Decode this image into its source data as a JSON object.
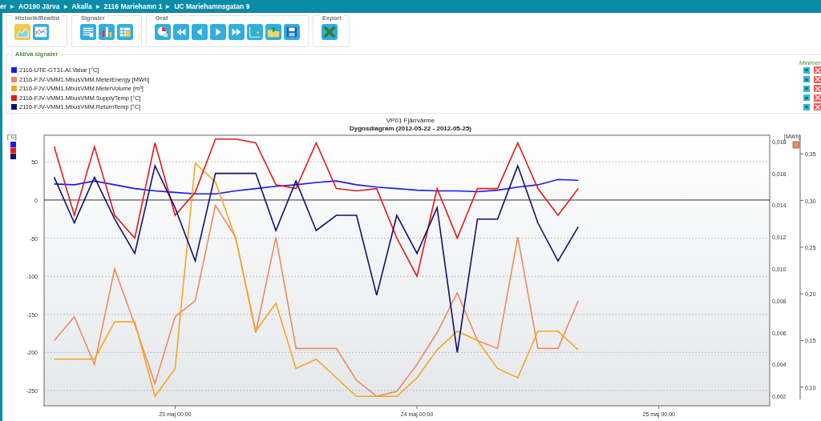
{
  "breadcrumb": {
    "separator": "▶",
    "items": [
      "er",
      "AO190 Järva",
      "Akalla",
      "2116 Mariehamn 1",
      "UC Mariehamnsgatan 9"
    ]
  },
  "toolbar": {
    "groups": [
      {
        "label": "Historik/Realtid",
        "buttons": [
          {
            "kind": "history",
            "selected": true
          },
          {
            "kind": "realtime",
            "selected": false
          }
        ]
      },
      {
        "label": "Signaler",
        "buttons": [
          {
            "kind": "list"
          },
          {
            "kind": "bars"
          },
          {
            "kind": "table"
          }
        ]
      },
      {
        "label": "Graf",
        "buttons": [
          {
            "kind": "pie"
          },
          {
            "kind": "rewind"
          },
          {
            "kind": "back"
          },
          {
            "kind": "forward"
          },
          {
            "kind": "fastforward"
          },
          {
            "kind": "scatter"
          },
          {
            "kind": "folder"
          },
          {
            "kind": "save"
          }
        ]
      },
      {
        "label": "Export",
        "buttons": [
          {
            "kind": "excel"
          }
        ]
      }
    ]
  },
  "signals": {
    "title": "Aktiva signaler",
    "column": "Minimer",
    "items": [
      {
        "name": "2116-UTE-GT31.AI.Value [°C]",
        "color": "#1a1aee"
      },
      {
        "name": "2116-FJV-VMM1.MbusVMM.MeterEnergy [MWh]",
        "color": "#f08a60"
      },
      {
        "name": "2116-FJV-VMM1.MbusVMM.MeterVolume [m³]",
        "color": "#f5a623"
      },
      {
        "name": "2116-FJV-VMM1.MbusVMM.SupplyTemp [°C]",
        "color": "#e81818"
      },
      {
        "name": "2116-FJV-VMM1.MbusVMM.ReturnTemp [°C]",
        "color": "#10106e"
      }
    ]
  },
  "chart": {
    "chart_data": {
      "type": "line",
      "title": "VP01 Fjärrvärme",
      "subtitle": "Dygnsdiagram (2012-05-22 - 2012-05-25)",
      "ylabel": "[°C]",
      "y2label": "[MWh]",
      "categories": [
        null,
        null,
        null,
        null,
        null,
        null,
        "23 maj 00:00",
        null,
        null,
        null,
        null,
        null,
        null,
        null,
        null,
        null,
        null,
        null,
        "24 maj 00:00",
        null,
        null,
        null,
        null,
        null,
        null,
        null,
        null,
        null,
        null,
        null,
        "25 maj 00:00",
        null,
        null,
        null,
        null,
        null
      ],
      "grid": true,
      "ylim": [
        -270,
        85
      ],
      "y2lim": [
        0.0014,
        0.0184
      ],
      "y3lim": [
        0.08,
        0.37
      ],
      "yticks": [
        50,
        0,
        -50,
        -100,
        -150,
        -200,
        -250
      ],
      "y2ticks": [
        {
          "value": 0.018,
          "label": "0,018"
        },
        {
          "value": 0.016,
          "label": "0,016"
        },
        {
          "value": 0.014,
          "label": "0,014"
        },
        {
          "value": 0.012,
          "label": "0,012"
        },
        {
          "value": 0.01,
          "label": "0,010"
        },
        {
          "value": 0.008,
          "label": "0,008"
        },
        {
          "value": 0.006,
          "label": "0,006"
        },
        {
          "value": 0.004,
          "label": "0,004"
        },
        {
          "value": 0.002,
          "label": "0,002"
        }
      ],
      "y3ticks": [
        {
          "value": 0.35,
          "label": "0,35"
        },
        {
          "value": 0.3,
          "label": "0,30"
        },
        {
          "value": 0.25,
          "label": "0,25"
        },
        {
          "value": 0.2,
          "label": "0,20"
        },
        {
          "value": 0.15,
          "label": "0,15"
        },
        {
          "value": 0.1,
          "label": "0,10"
        }
      ],
      "series": [
        {
          "color": "#1a1aee",
          "values": [
            21,
            20,
            25,
            20,
            15,
            12,
            10,
            8,
            8,
            12,
            15,
            18,
            20,
            23,
            25,
            20,
            17,
            15,
            13,
            12,
            12,
            11,
            13,
            17,
            20,
            27,
            26,
            null,
            null,
            null,
            null,
            null,
            null,
            null,
            null,
            null
          ]
        },
        {
          "color": "#f08a60",
          "axis": "y2",
          "values": [
            0.0055,
            0.007,
            0.004,
            0.01,
            0.0065,
            0.0028,
            0.007,
            0.008,
            0.014,
            0.012,
            0.006,
            0.012,
            0.005,
            0.005,
            0.005,
            0.003,
            0.002,
            0.0023,
            0.004,
            0.006,
            0.0085,
            0.0055,
            0.005,
            0.012,
            0.005,
            0.005,
            0.008,
            null,
            null,
            null,
            null,
            null,
            null,
            null,
            null,
            null
          ]
        },
        {
          "color": "#f5a623",
          "axis": "y3",
          "values": [
            0.13,
            0.13,
            0.13,
            0.17,
            0.17,
            0.09,
            0.12,
            0.34,
            0.32,
            0.26,
            0.16,
            0.19,
            0.12,
            0.13,
            0.11,
            0.09,
            0.09,
            0.09,
            0.11,
            0.14,
            0.16,
            0.15,
            0.12,
            0.11,
            0.16,
            0.16,
            0.14,
            null,
            null,
            null,
            null,
            null,
            null,
            null,
            null,
            null
          ]
        },
        {
          "color": "#e81818",
          "values": [
            70,
            -20,
            70,
            -20,
            -50,
            75,
            -20,
            10,
            80,
            80,
            75,
            20,
            15,
            75,
            15,
            12,
            15,
            -50,
            -100,
            15,
            -50,
            15,
            15,
            75,
            15,
            -20,
            15,
            null,
            null,
            null,
            null,
            null,
            null,
            null,
            null,
            null
          ]
        },
        {
          "color": "#10106e",
          "values": [
            30,
            -30,
            30,
            -25,
            -70,
            45,
            -10,
            -80,
            35,
            35,
            35,
            -40,
            25,
            -40,
            -20,
            -20,
            -125,
            -20,
            -70,
            -10,
            -200,
            -25,
            -25,
            45,
            -30,
            -80,
            -35,
            null,
            null,
            null,
            null,
            null,
            null,
            null,
            null,
            null
          ]
        }
      ]
    }
  }
}
